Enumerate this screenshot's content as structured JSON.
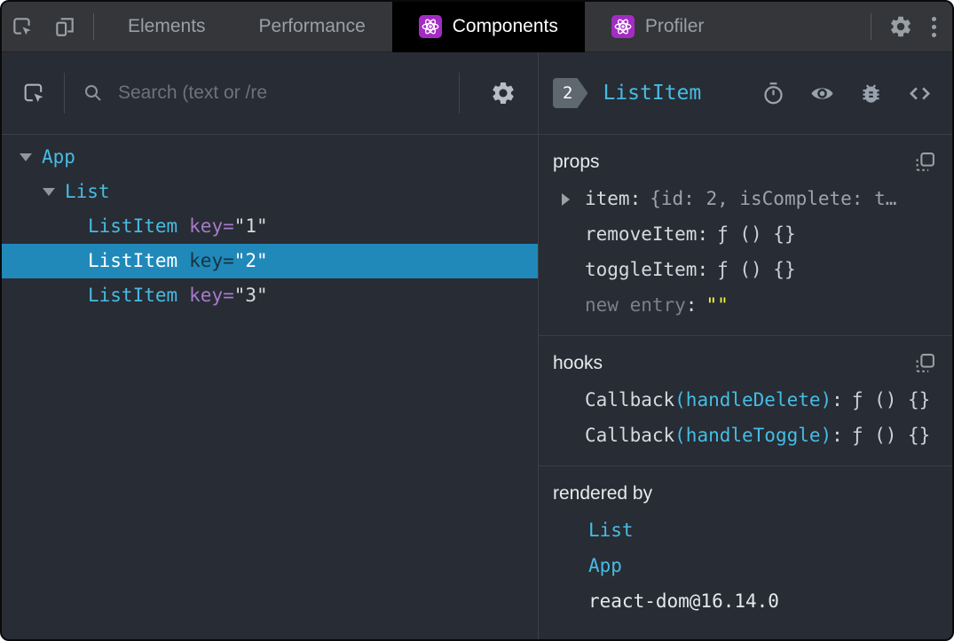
{
  "topbar": {
    "tabs": [
      {
        "label": "Elements",
        "active": false
      },
      {
        "label": "Performance",
        "active": false
      },
      {
        "label": "Components",
        "active": true,
        "icon": "react-logo-icon"
      },
      {
        "label": "Profiler",
        "active": false,
        "icon": "react-logo-icon"
      }
    ]
  },
  "left_panel": {
    "search": {
      "placeholder": "Search (text or /re"
    },
    "tree": [
      {
        "label": "App",
        "depth": 0,
        "expanded": true,
        "selected": false
      },
      {
        "label": "List",
        "depth": 1,
        "expanded": true,
        "selected": false
      },
      {
        "label": "ListItem",
        "attr": "key",
        "eq": "=",
        "value": "\"1\"",
        "depth": 2,
        "selected": false
      },
      {
        "label": "ListItem",
        "attr": "key",
        "eq": "=",
        "value": "\"2\"",
        "depth": 2,
        "selected": true
      },
      {
        "label": "ListItem",
        "attr": "key",
        "eq": "=",
        "value": "\"3\"",
        "depth": 2,
        "selected": false
      }
    ]
  },
  "right_panel": {
    "header": {
      "badge": "2",
      "component": "ListItem"
    },
    "props": {
      "title": "props",
      "rows": [
        {
          "key": "item",
          "sep": ":",
          "value": "{id: 2, isComplete: t…",
          "expandable": true
        },
        {
          "key": "removeItem",
          "sep": ":",
          "value": "ƒ () {}"
        },
        {
          "key": "toggleItem",
          "sep": ":",
          "value": "ƒ () {}"
        },
        {
          "key": "new entry",
          "sep": ":",
          "value": "\"\""
        }
      ]
    },
    "hooks": {
      "title": "hooks",
      "rows": [
        {
          "name": "Callback",
          "paren": "(handleDelete)",
          "sep": ":",
          "value": "ƒ () {}"
        },
        {
          "name": "Callback",
          "paren": "(handleToggle)",
          "sep": ":",
          "value": "ƒ () {}"
        }
      ]
    },
    "rendered_by": {
      "title": "rendered by",
      "items": [
        "List",
        "App",
        "react-dom@16.14.0"
      ]
    }
  },
  "icons": {
    "topbar": [
      "inspect-icon",
      "device-toolbar-icon",
      "react-logo-icon",
      "settings-gear-icon",
      "kebab-menu-icon"
    ],
    "left_toolbar": [
      "element-picker-icon",
      "search-icon",
      "settings-gear-icon"
    ],
    "right_header": [
      "stopwatch-icon",
      "eye-icon",
      "bug-icon",
      "view-source-icon"
    ],
    "sections": [
      "copy-icon"
    ],
    "tree": [
      "chevron-down-icon",
      "chevron-right-icon"
    ]
  },
  "colors": {
    "accent_cyan": "#46bce4",
    "selected_row": "#2089ba",
    "react_purple": "#a32cc4",
    "key_purple": "#a57bc8",
    "string_yellow": "#f6f63c",
    "background": "#282c34",
    "topbar_bg": "#343639",
    "active_tab_bg": "#000000"
  }
}
